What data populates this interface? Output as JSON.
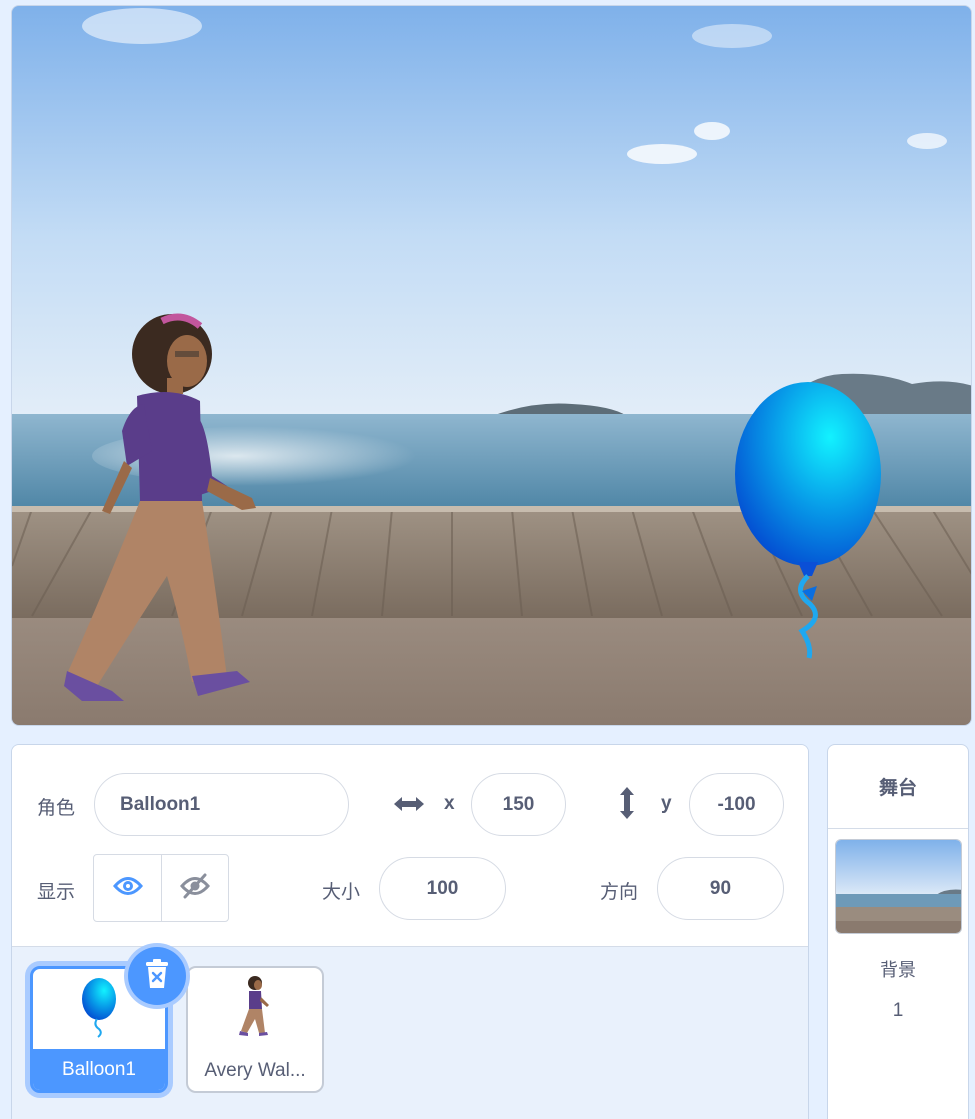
{
  "sprite_info": {
    "sprite_label": "角色",
    "sprite_name": "Balloon1",
    "x_label": "x",
    "x_value": "150",
    "y_label": "y",
    "y_value": "-100",
    "show_label": "显示",
    "size_label": "大小",
    "size_value": "100",
    "direction_label": "方向",
    "direction_value": "90"
  },
  "sprites": [
    {
      "name": "Balloon1",
      "selected": true,
      "icon": "balloon-icon"
    },
    {
      "name": "Avery Wal...",
      "selected": false,
      "icon": "avery-icon"
    }
  ],
  "stage_panel": {
    "title": "舞台",
    "backdrops_label": "背景",
    "backdrops_count": "1"
  },
  "colors": {
    "accent": "#4c97ff",
    "accent_glow": "#a9cbff",
    "text": "#575e75",
    "background": "#e5f0ff"
  }
}
